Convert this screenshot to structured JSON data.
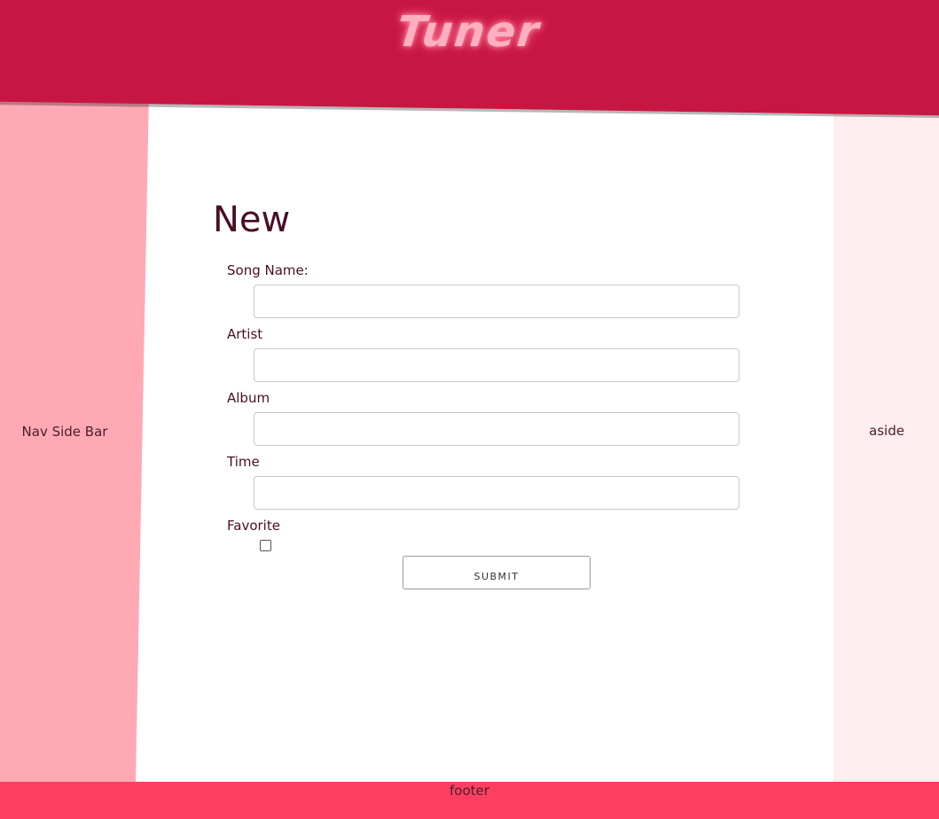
{
  "header": {
    "logo": "Tuner"
  },
  "nav": {
    "label": "Nav Side Bar"
  },
  "aside": {
    "label": "aside"
  },
  "main": {
    "title": "New",
    "form": {
      "song_name_label": "Song Name:",
      "artist_label": "Artist",
      "album_label": "Album",
      "time_label": "Time",
      "favorite_label": "Favorite",
      "song_name_value": "",
      "artist_value": "",
      "album_value": "",
      "time_value": "",
      "favorite_checked": false,
      "submit_label": "SUBMIT"
    }
  },
  "footer": {
    "label": "footer"
  },
  "colors": {
    "header": "#c81642",
    "nav": "#ffa9b5",
    "aside": "#ffedf0",
    "footer": "#ff3f62",
    "text": "#4a0e26",
    "logo": "#ffb0c0"
  }
}
